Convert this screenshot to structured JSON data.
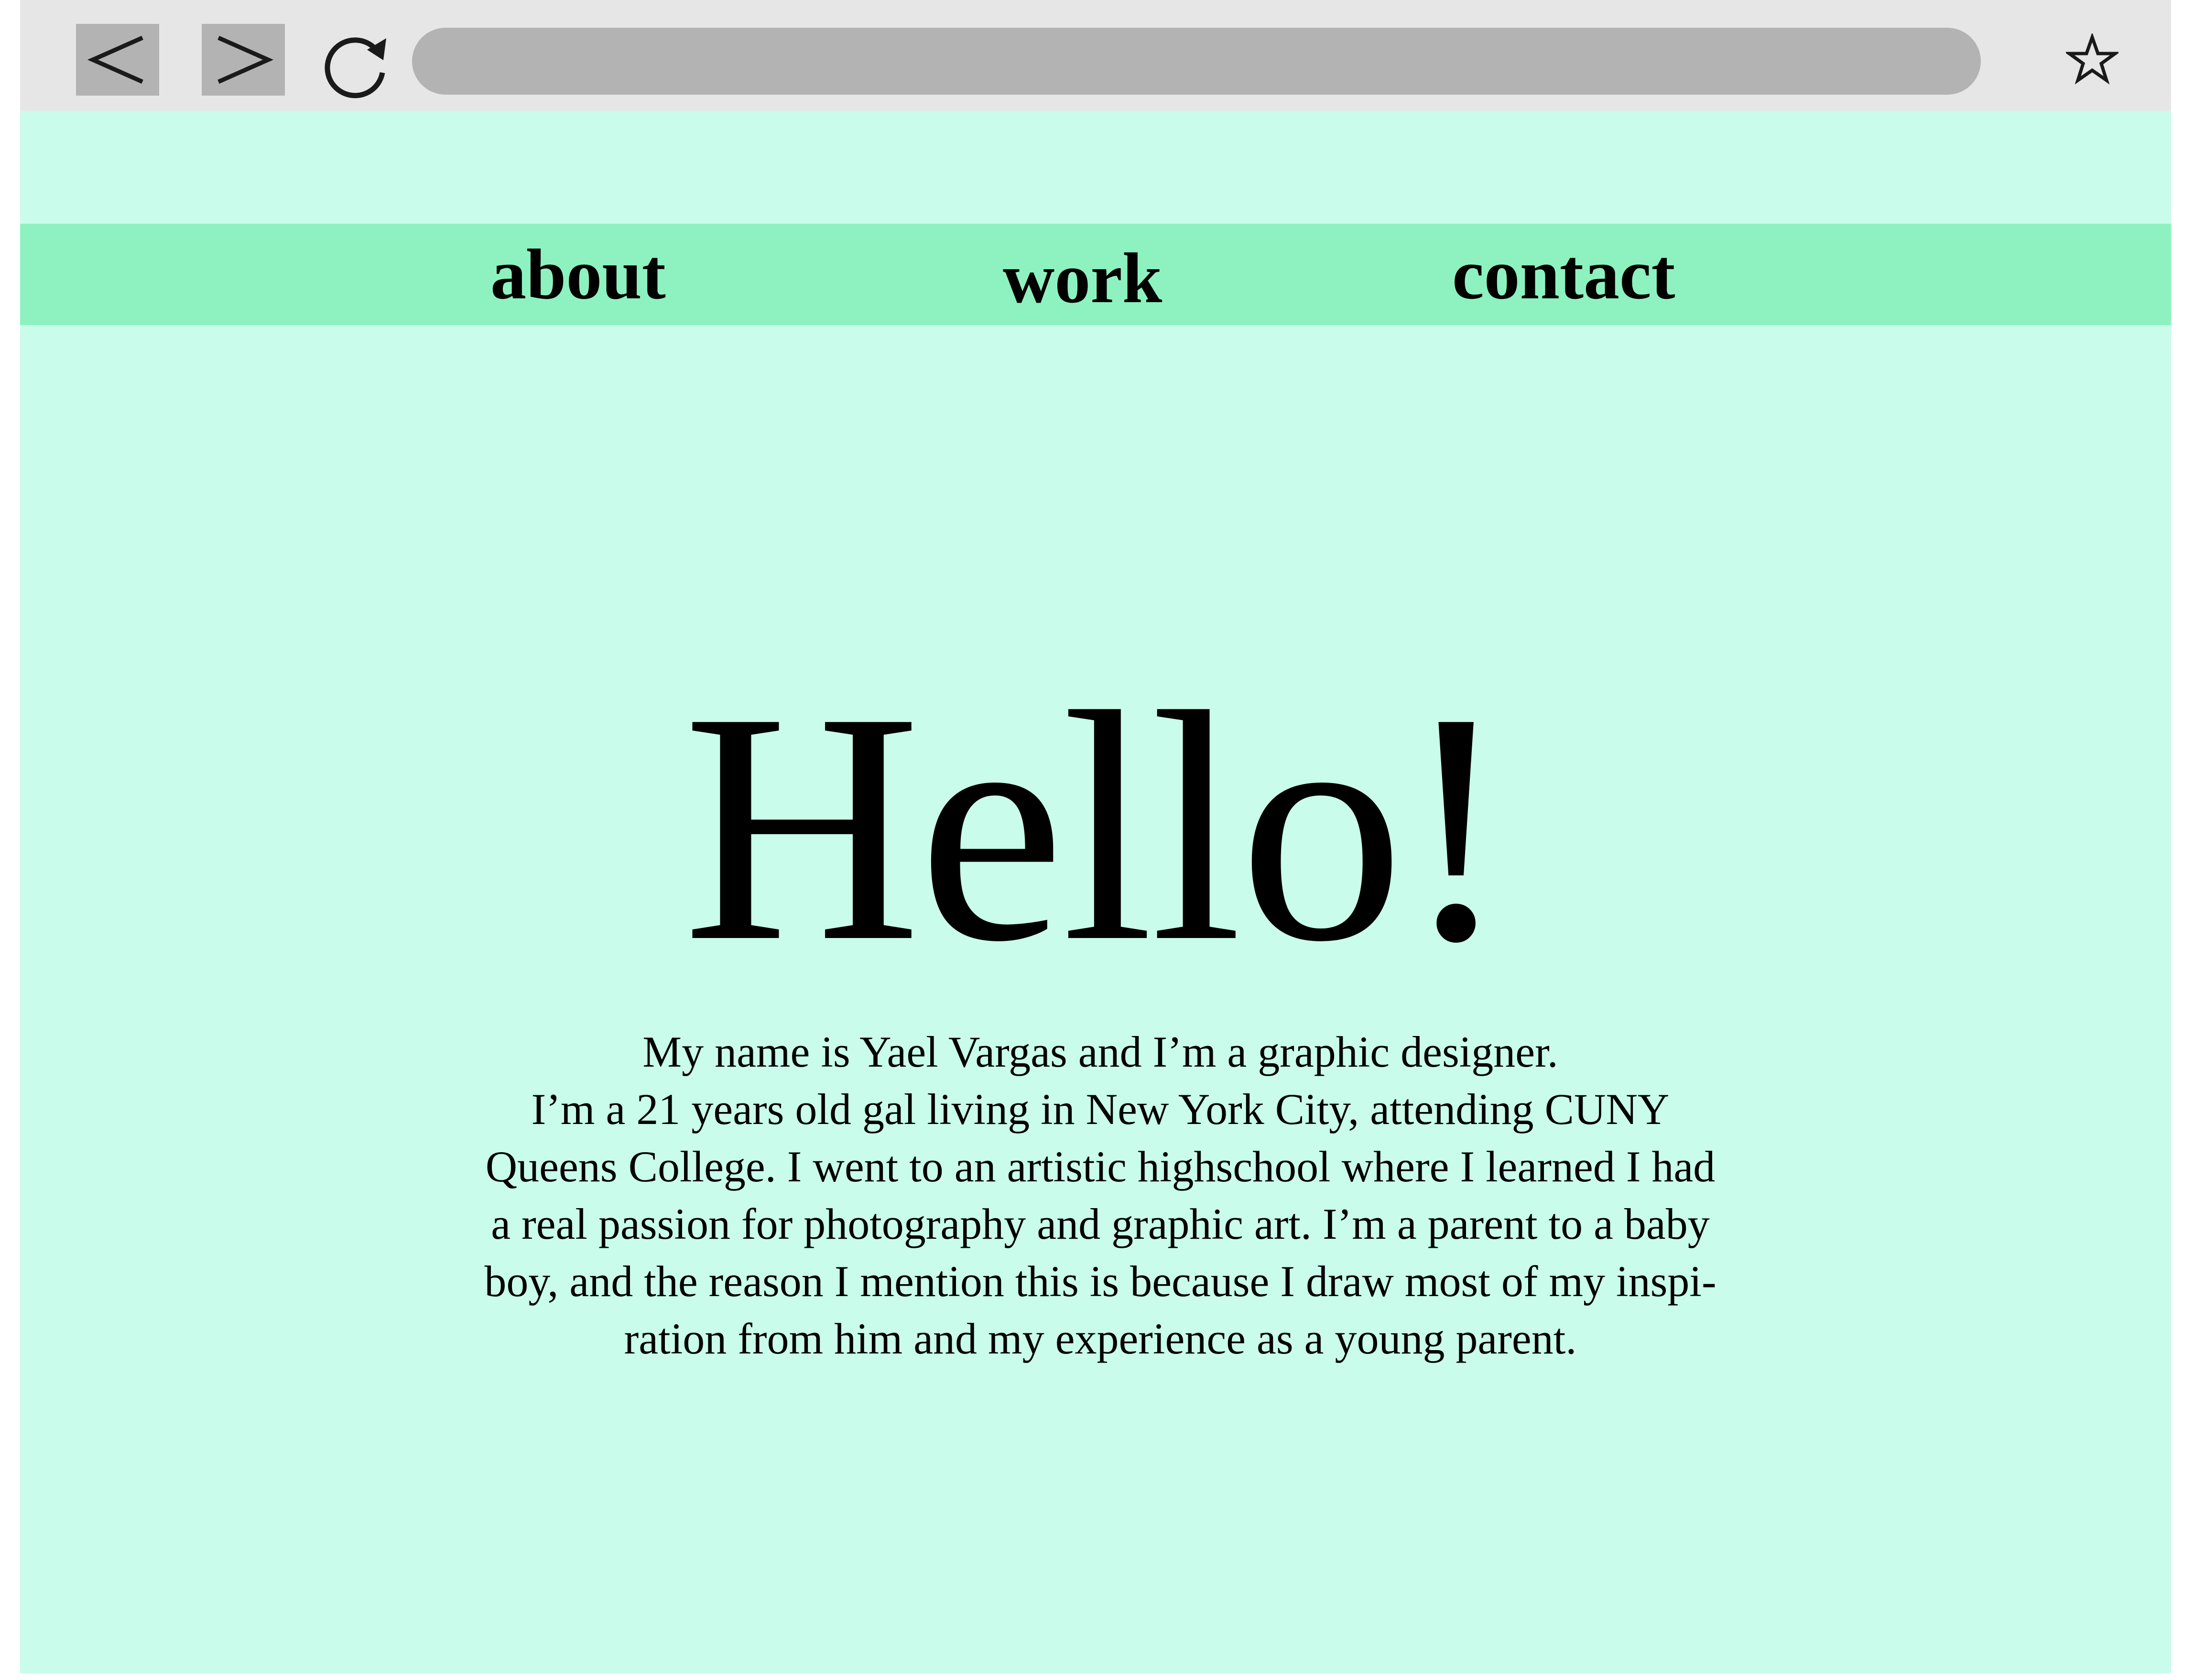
{
  "browser": {
    "back_icon": "chevron-left-icon",
    "forward_icon": "chevron-right-icon",
    "reload_icon": "reload-icon",
    "bookmark_icon": "star-icon",
    "url": ""
  },
  "colors": {
    "page_background": "#c9fcea",
    "nav_background": "#8df2bf",
    "toolbar_background": "#e6e6e6",
    "toolbar_controls": "#b3b3b3",
    "text": "#000000"
  },
  "nav": {
    "items": [
      {
        "label": "about"
      },
      {
        "label": "work"
      },
      {
        "label": "contact"
      }
    ]
  },
  "main": {
    "heading": "Hello!",
    "bio_lines": [
      "My name is Yael Vargas and I’m a graphic designer.",
      "I’m a 21 years old gal living in New York City, attending CUNY",
      "Queens College. I went to an artistic highschool where I learned I had",
      "a real passion for photography and graphic art. I’m a parent to a baby",
      "boy, and the reason I mention this is because I draw most of  my inspi-",
      "ration from him and my experience as a young parent."
    ]
  }
}
